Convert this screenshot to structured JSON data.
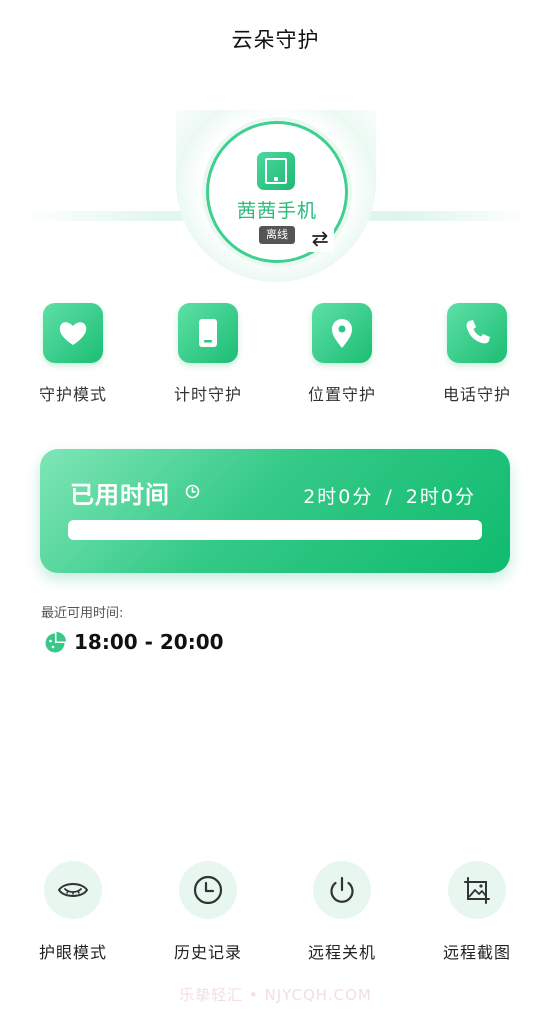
{
  "header": {
    "title": "云朵守护"
  },
  "device": {
    "name": "茜茜手机",
    "status": "离线",
    "icon": "tablet-icon",
    "switch_icon": "swap-icon"
  },
  "features": [
    {
      "label": "守护模式",
      "icon": "heart-icon"
    },
    {
      "label": "计时守护",
      "icon": "phone-timer-icon"
    },
    {
      "label": "位置守护",
      "icon": "location-pin-icon"
    },
    {
      "label": "电话守护",
      "icon": "phone-call-icon"
    }
  ],
  "usage": {
    "title": "已用时间",
    "used": "2时0分",
    "separator": "/",
    "total": "2时0分",
    "progress_fraction": 1.0
  },
  "schedule": {
    "label": "最近可用时间:",
    "time_range": "18:00 - 20:00"
  },
  "tools": [
    {
      "label": "护眼模式",
      "icon": "eye-icon"
    },
    {
      "label": "历史记录",
      "icon": "clock-icon"
    },
    {
      "label": "远程关机",
      "icon": "power-icon"
    },
    {
      "label": "远程截图",
      "icon": "screenshot-icon"
    }
  ],
  "watermark": "乐挚轻汇 • NJYCQH.COM",
  "colors": {
    "accent": "#1fbd74",
    "accent_light": "#e7f7f0",
    "badge": "#555555"
  }
}
